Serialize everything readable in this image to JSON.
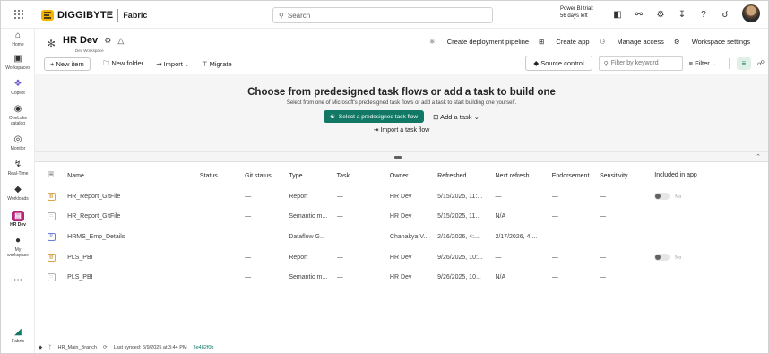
{
  "topbar": {
    "brand": "DIGGIBYTE",
    "product": "Fabric",
    "search_placeholder": "Search",
    "trial_line1": "Power BI trial:",
    "trial_line2": "56 days left"
  },
  "nav": {
    "items": [
      {
        "label": "Home",
        "icon": "home-icon"
      },
      {
        "label": "Workspaces",
        "icon": "workspaces-icon"
      },
      {
        "label": "Copilot",
        "icon": "copilot-icon"
      },
      {
        "label": "OneLake catalog",
        "icon": "onelake-icon"
      },
      {
        "label": "Monitor",
        "icon": "monitor-icon"
      },
      {
        "label": "Real-Time",
        "icon": "realtime-icon"
      },
      {
        "label": "Workloads",
        "icon": "workloads-icon"
      },
      {
        "label": "HR Dev",
        "icon": "workspace-hrdev-icon"
      },
      {
        "label": "My workspace",
        "icon": "my-workspace-icon"
      },
      {
        "label": "Fabric",
        "icon": "fabric-icon"
      }
    ]
  },
  "workspace": {
    "title": "HR Dev",
    "subtitle": "Dev Workspace",
    "actions": {
      "deploy": "Create deployment pipeline",
      "create_app": "Create app",
      "manage_access": "Manage access",
      "settings": "Workspace settings"
    }
  },
  "toolbar": {
    "new_item": "+ New item",
    "new_folder": "New folder",
    "import": "Import",
    "migrate": "Migrate",
    "source_control": "Source control",
    "filter_placeholder": "Filter by keyword",
    "filter": "Filter"
  },
  "hero": {
    "title": "Choose from predesigned task flows or add a task to build one",
    "subtitle": "Select from one of Microsoft's predesigned task flows or add a task to start building one yourself.",
    "select_btn": "Select a predesigned task flow",
    "add_task": "Add a task",
    "import_flow": "Import a task flow"
  },
  "table": {
    "headers": [
      "Name",
      "Status",
      "Git status",
      "Type",
      "Task",
      "Owner",
      "Refreshed",
      "Next refresh",
      "Endorsement",
      "Sensitivity",
      "Included in app"
    ],
    "rows": [
      {
        "icon": "report",
        "name": "HR_Report_GitFile",
        "status": "",
        "git": "—",
        "type": "Report",
        "task": "—",
        "owner": "HR Dev",
        "refreshed": "5/15/2025, 11:...",
        "next": "—",
        "endorse": "—",
        "sens": "—",
        "inapp": "No"
      },
      {
        "icon": "semantic",
        "name": "HR_Report_GitFile",
        "status": "",
        "git": "—",
        "type": "Semantic m...",
        "task": "—",
        "owner": "HR Dev",
        "refreshed": "5/15/2025, 11...",
        "next": "N/A",
        "endorse": "—",
        "sens": "—",
        "inapp": ""
      },
      {
        "icon": "dataflow",
        "name": "HRMS_Emp_Details",
        "status": "",
        "git": "—",
        "type": "Dataflow G...",
        "task": "—",
        "owner": "Chanakya V...",
        "refreshed": "2/16/2026, 4:...",
        "next": "2/17/2026, 4:...",
        "endorse": "—",
        "sens": "—",
        "inapp": ""
      },
      {
        "icon": "report",
        "name": "PLS_PBI",
        "status": "",
        "git": "—",
        "type": "Report",
        "task": "—",
        "owner": "HR Dev",
        "refreshed": "9/26/2025, 10:...",
        "next": "—",
        "endorse": "—",
        "sens": "—",
        "inapp": "No"
      },
      {
        "icon": "semantic",
        "name": "PLS_PBI",
        "status": "",
        "git": "—",
        "type": "Semantic m...",
        "task": "—",
        "owner": "HR Dev",
        "refreshed": "9/26/2025, 10...",
        "next": "N/A",
        "endorse": "—",
        "sens": "—",
        "inapp": ""
      }
    ]
  },
  "statusbar": {
    "branch": "HR_Main_Branch",
    "synced": "Last synced: 6/9/2025 at 3:44 PM",
    "commit": "3e482f0b"
  },
  "colors": {
    "accent": "#117865",
    "workspace": "#b4267a"
  }
}
